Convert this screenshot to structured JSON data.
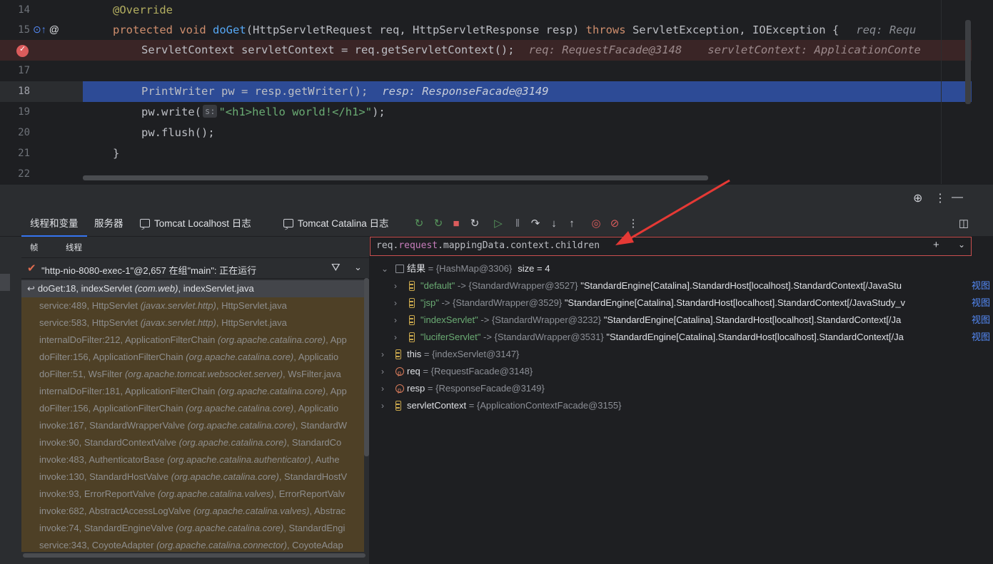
{
  "editor": {
    "lines": [
      {
        "num": "14"
      },
      {
        "num": "15"
      },
      {
        "num": ""
      },
      {
        "num": "17"
      },
      {
        "num": "18"
      },
      {
        "num": "19"
      },
      {
        "num": "20"
      },
      {
        "num": "21"
      },
      {
        "num": "22"
      }
    ],
    "code": {
      "l14": "@Override",
      "l15_kw1": "protected",
      "l15_kw2": "void",
      "l15_fn": "doGet",
      "l15_rest1": "(HttpServletRequest req, HttpServletResponse resp) ",
      "l15_kw3": "throws",
      "l15_rest2": " ServletException, IOException {",
      "l15_hint": "req: Requ",
      "l16_code": "ServletContext servletContext = req.getServletContext();",
      "l16_hint1": "req: RequestFacade@3148",
      "l16_hint2": "servletContext: ApplicationConte",
      "l18_code": "PrintWriter pw = resp.getWriter();",
      "l18_hint": "resp: ResponseFacade@3149",
      "l19_a": "pw.write(",
      "l19_param": "s:",
      "l19_str": "\"<h1>hello world!</h1>\"",
      "l19_b": ");",
      "l20": "pw.flush();",
      "l21": "}"
    }
  },
  "tabs": {
    "threads_vars": "线程和变量",
    "server": "服务器",
    "tomcat_localhost": "Tomcat Localhost 日志",
    "tomcat_catalina": "Tomcat Catalina 日志"
  },
  "frames_panel": {
    "subtab_frames": "帧",
    "subtab_threads": "线程",
    "thread_label": "\"http-nio-8080-exec-1\"@2,657 在组\"main\": 正在运行",
    "frames": [
      {
        "method": "doGet:18, indexServlet",
        "pkg": "(com.web)",
        "file": ", indexServlet.java"
      },
      {
        "method": "service:489, HttpServlet",
        "pkg": "(javax.servlet.http)",
        "file": ", HttpServlet.java"
      },
      {
        "method": "service:583, HttpServlet",
        "pkg": "(javax.servlet.http)",
        "file": ", HttpServlet.java"
      },
      {
        "method": "internalDoFilter:212, ApplicationFilterChain",
        "pkg": "(org.apache.catalina.core)",
        "file": ", App"
      },
      {
        "method": "doFilter:156, ApplicationFilterChain",
        "pkg": "(org.apache.catalina.core)",
        "file": ", Applicatio"
      },
      {
        "method": "doFilter:51, WsFilter",
        "pkg": "(org.apache.tomcat.websocket.server)",
        "file": ", WsFilter.java"
      },
      {
        "method": "internalDoFilter:181, ApplicationFilterChain",
        "pkg": "(org.apache.catalina.core)",
        "file": ", App"
      },
      {
        "method": "doFilter:156, ApplicationFilterChain",
        "pkg": "(org.apache.catalina.core)",
        "file": ", Applicatio"
      },
      {
        "method": "invoke:167, StandardWrapperValve",
        "pkg": "(org.apache.catalina.core)",
        "file": ", StandardW"
      },
      {
        "method": "invoke:90, StandardContextValve",
        "pkg": "(org.apache.catalina.core)",
        "file": ", StandardCo"
      },
      {
        "method": "invoke:483, AuthenticatorBase",
        "pkg": "(org.apache.catalina.authenticator)",
        "file": ", Authe"
      },
      {
        "method": "invoke:130, StandardHostValve",
        "pkg": "(org.apache.catalina.core)",
        "file": ", StandardHostV"
      },
      {
        "method": "invoke:93, ErrorReportValve",
        "pkg": "(org.apache.catalina.valves)",
        "file": ", ErrorReportValv"
      },
      {
        "method": "invoke:682, AbstractAccessLogValve",
        "pkg": "(org.apache.catalina.valves)",
        "file": ", Abstrac"
      },
      {
        "method": "invoke:74, StandardEngineValve",
        "pkg": "(org.apache.catalina.core)",
        "file": ", StandardEngi"
      },
      {
        "method": "service:343, CoyoteAdapter",
        "pkg": "(org.apache.catalina.connector)",
        "file": ", CoyoteAdap"
      }
    ]
  },
  "variables": {
    "expression_a": "req.",
    "expression_req": "request",
    "expression_b": ".mappingData.context.children",
    "result": {
      "name": "结果",
      "type": "{HashMap@3306}",
      "size": "size = 4"
    },
    "entries": [
      {
        "key": "\"default\"",
        "arrow": " -> ",
        "type": "{StandardWrapper@3527}",
        "value": " \"StandardEngine[Catalina].StandardHost[localhost].StandardContext[/JavaStu",
        "link": "视图"
      },
      {
        "key": "\"jsp\"",
        "arrow": " -> ",
        "type": "{StandardWrapper@3529}",
        "value": " \"StandardEngine[Catalina].StandardHost[localhost].StandardContext[/JavaStudy_v",
        "link": "视图"
      },
      {
        "key": "\"indexServlet\"",
        "arrow": " -> ",
        "type": "{StandardWrapper@3232}",
        "value": " \"StandardEngine[Catalina].StandardHost[localhost].StandardContext[/Ja",
        "link": "视图"
      },
      {
        "key": "\"luciferServlet\"",
        "arrow": " -> ",
        "type": "{StandardWrapper@3531}",
        "value": " \"StandardEngine[Catalina].StandardHost[localhost].StandardContext[/Ja",
        "link": "视图"
      }
    ],
    "vars": [
      {
        "name": "this",
        "eq": " = ",
        "type": "{indexServlet@3147}"
      },
      {
        "name": "req",
        "eq": " = ",
        "type": "{RequestFacade@3148}"
      },
      {
        "name": "resp",
        "eq": " = ",
        "type": "{ResponseFacade@3149}"
      },
      {
        "name": "servletContext",
        "eq": " = ",
        "type": "{ApplicationContextFacade@3155}"
      }
    ]
  },
  "colors": {
    "accent": "#3574f0",
    "breakpoint": "#db5c5c",
    "arrow": "#e53935"
  }
}
